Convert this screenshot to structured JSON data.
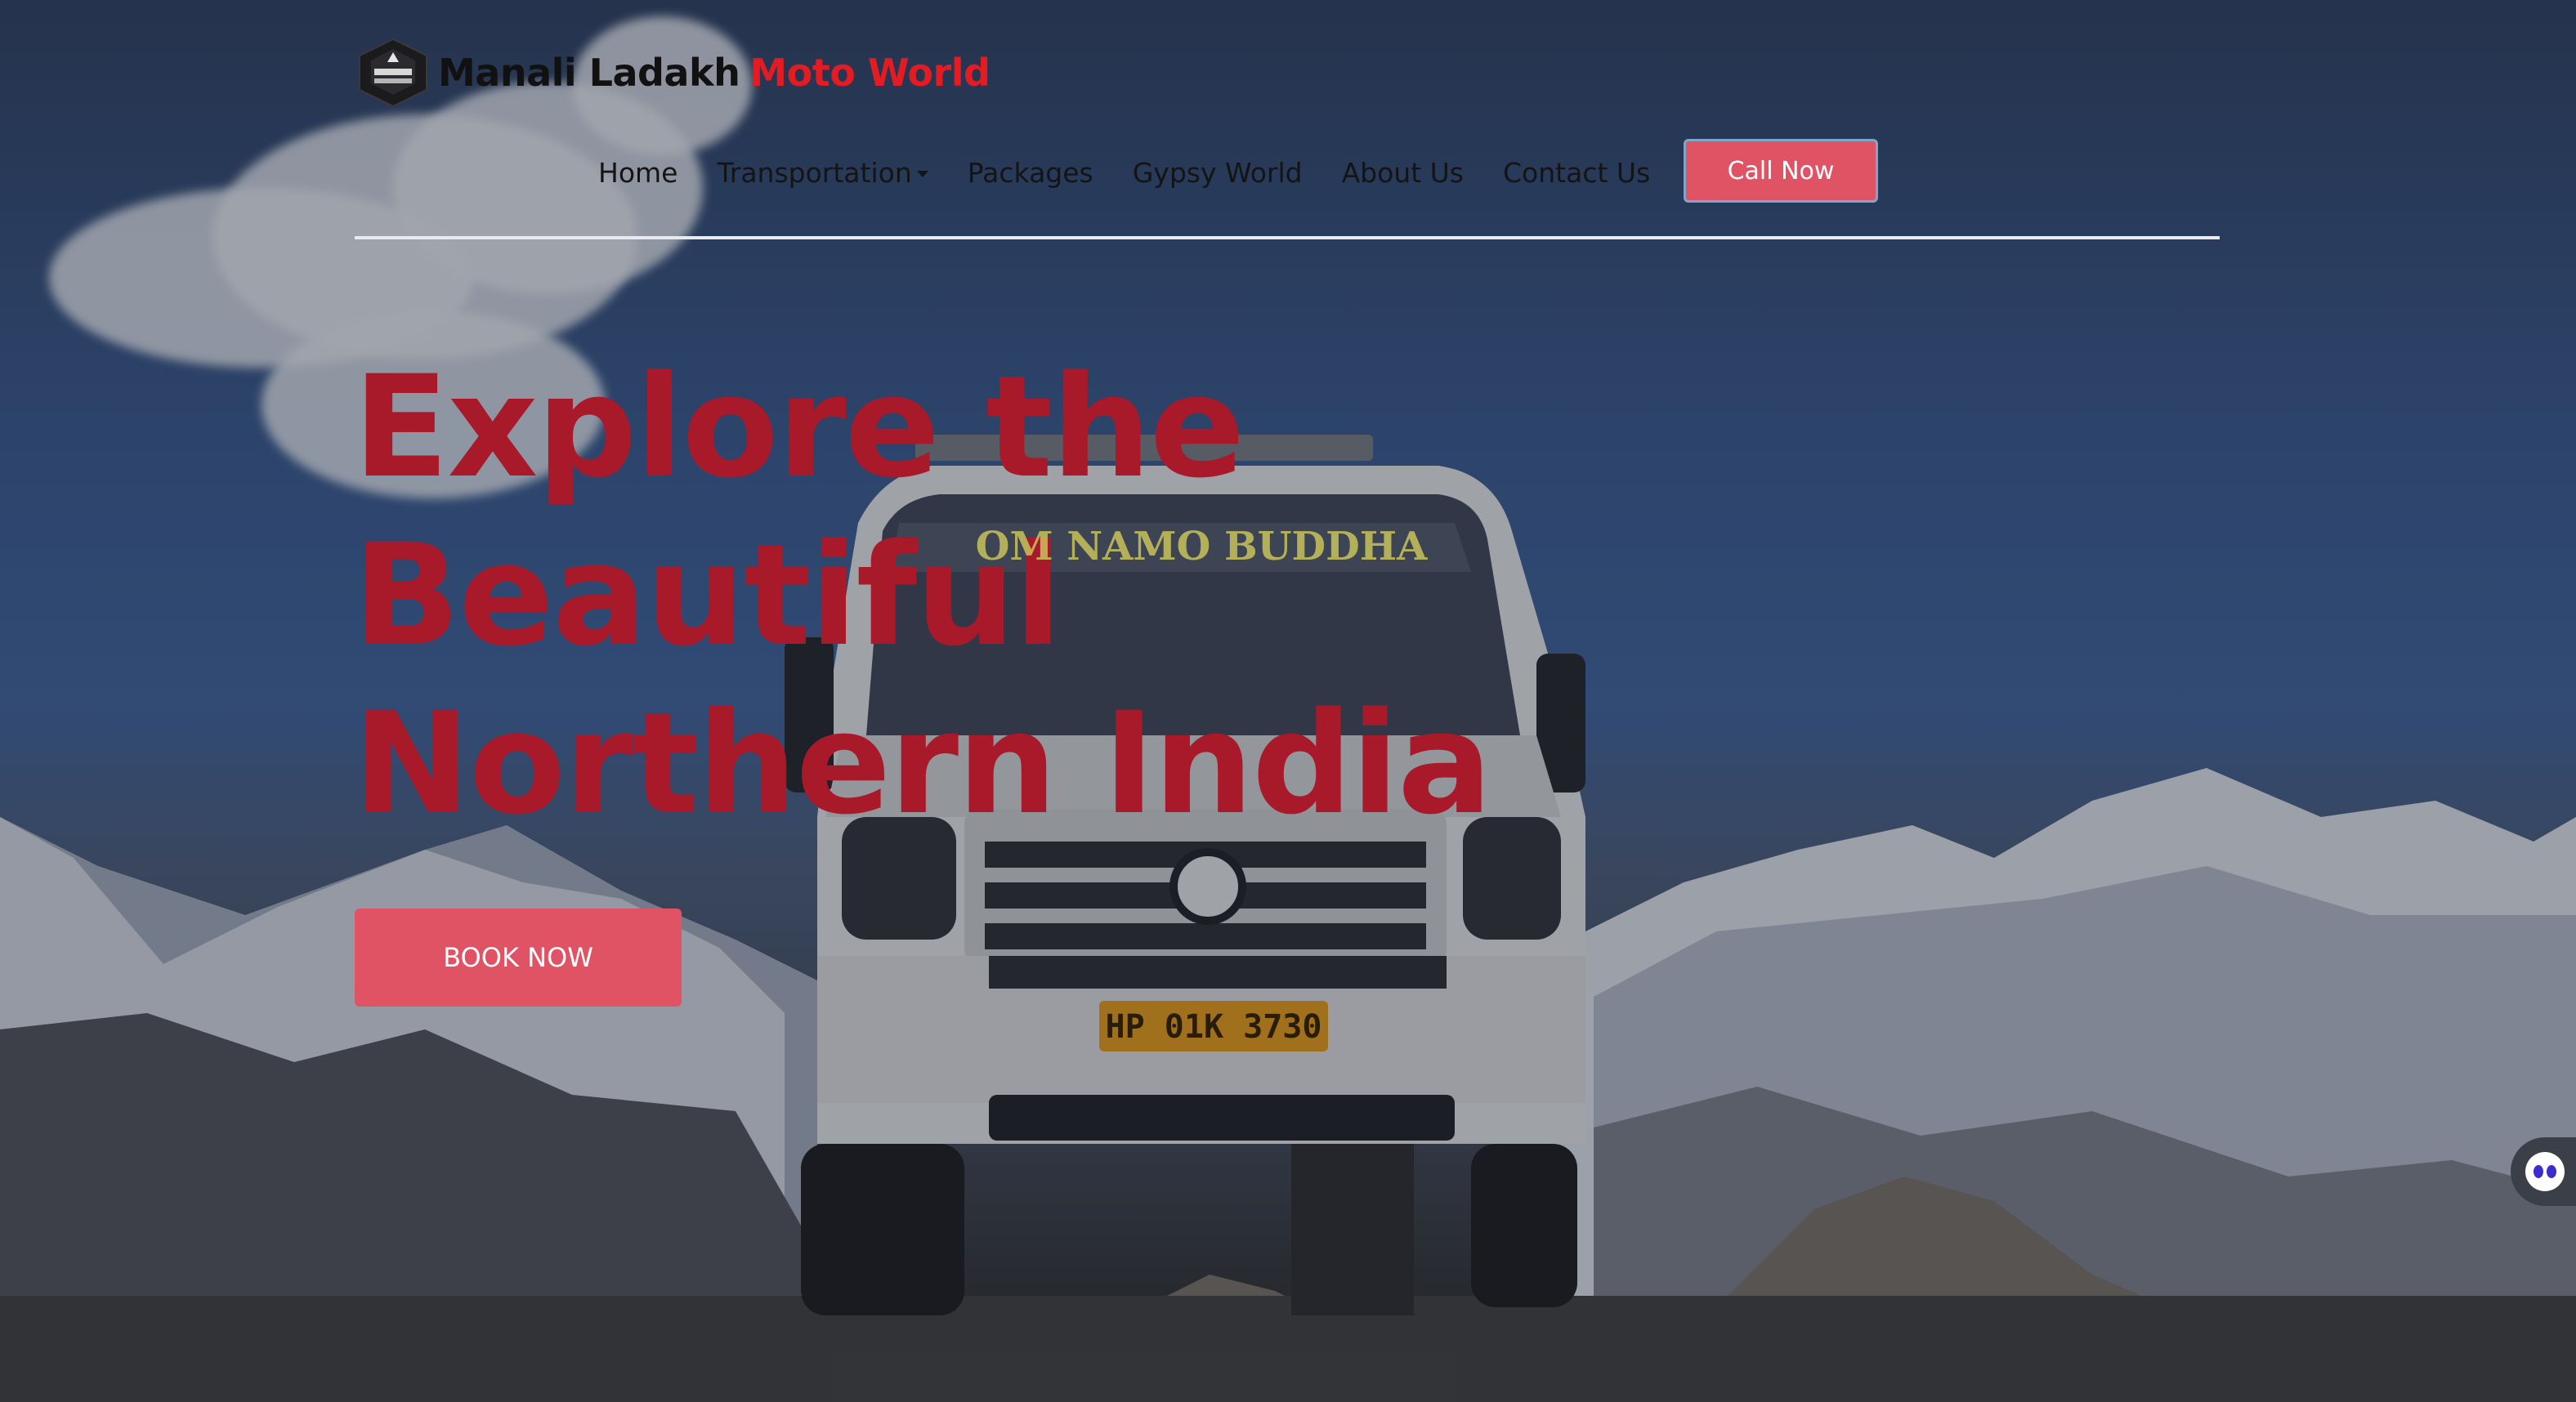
{
  "brand": {
    "name_part1": "Manali Ladakh",
    "name_part2": "Moto World",
    "logo_icon": "shield-emblem-icon"
  },
  "nav": {
    "items": [
      {
        "label": "Home"
      },
      {
        "label": "Transportation",
        "has_dropdown": true
      },
      {
        "label": "Packages"
      },
      {
        "label": "Gypsy World"
      },
      {
        "label": "About Us"
      },
      {
        "label": "Contact Us"
      }
    ],
    "call_button": "Call Now"
  },
  "hero": {
    "headline_line1": "Explore the",
    "headline_line2": "Beautiful",
    "headline_line3": "Northern India",
    "cta": "BOOK NOW",
    "van_signboard": "OM NAMO BUDDHA",
    "van_plate": "HP 01K 3730"
  },
  "colors": {
    "brand_red": "#e31b23",
    "headline_red": "#a8192a",
    "button_pink": "#e05365",
    "text_dark": "#141414"
  },
  "chat_widget": {
    "icon": "chat-bot-icon"
  }
}
